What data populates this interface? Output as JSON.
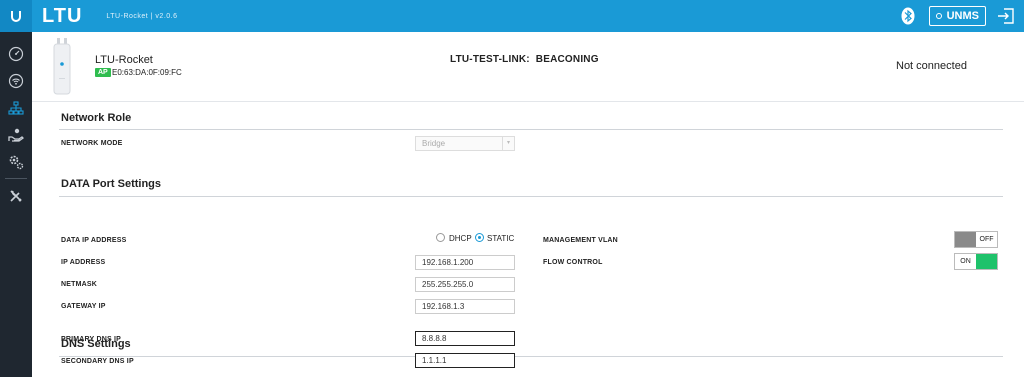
{
  "topbar": {
    "brand": "LTU",
    "subtitle": "LTU-Rocket | v2.0.6",
    "unms_label": "UNMS",
    "accent_color": "#1a9ad6",
    "icons": [
      "ubiquiti-logo-icon",
      "bluetooth-icon",
      "logout-icon"
    ]
  },
  "sidebar": {
    "items": [
      {
        "name": "dashboard-icon"
      },
      {
        "name": "wireless-icon"
      },
      {
        "name": "network-icon",
        "active": true
      },
      {
        "name": "services-icon"
      },
      {
        "name": "settings-icon"
      },
      {
        "name": "tools-icon"
      }
    ]
  },
  "device": {
    "name": "LTU-Rocket",
    "mode_badge": "AP",
    "mac": "E0:63:DA:0F:09:FC",
    "link_status": "LTU-TEST-LINK:  BEACONING",
    "connection_status": "Not connected"
  },
  "network_role": {
    "title": "Network Role",
    "network_mode_label": "NETWORK MODE",
    "network_mode_value": "Bridge"
  },
  "data_port": {
    "title": "DATA Port Settings",
    "data_ip_label": "DATA IP ADDRESS",
    "dhcp_label": "DHCP",
    "static_label": "STATIC",
    "ip_label": "IP ADDRESS",
    "ip_value": "192.168.1.200",
    "netmask_label": "NETMASK",
    "netmask_value": "255.255.255.0",
    "gateway_label": "GATEWAY IP",
    "gateway_value": "192.168.1.3",
    "mgmt_vlan_label": "MANAGEMENT VLAN",
    "mgmt_vlan_state": "OFF",
    "flow_control_label": "FLOW CONTROL",
    "flow_control_state": "ON"
  },
  "dns": {
    "title": "DNS Settings",
    "primary_label": "PRIMARY DNS IP",
    "primary_value": "8.8.8.8",
    "secondary_label": "SECONDARY DNS IP",
    "secondary_value": "1.1.1.1"
  }
}
